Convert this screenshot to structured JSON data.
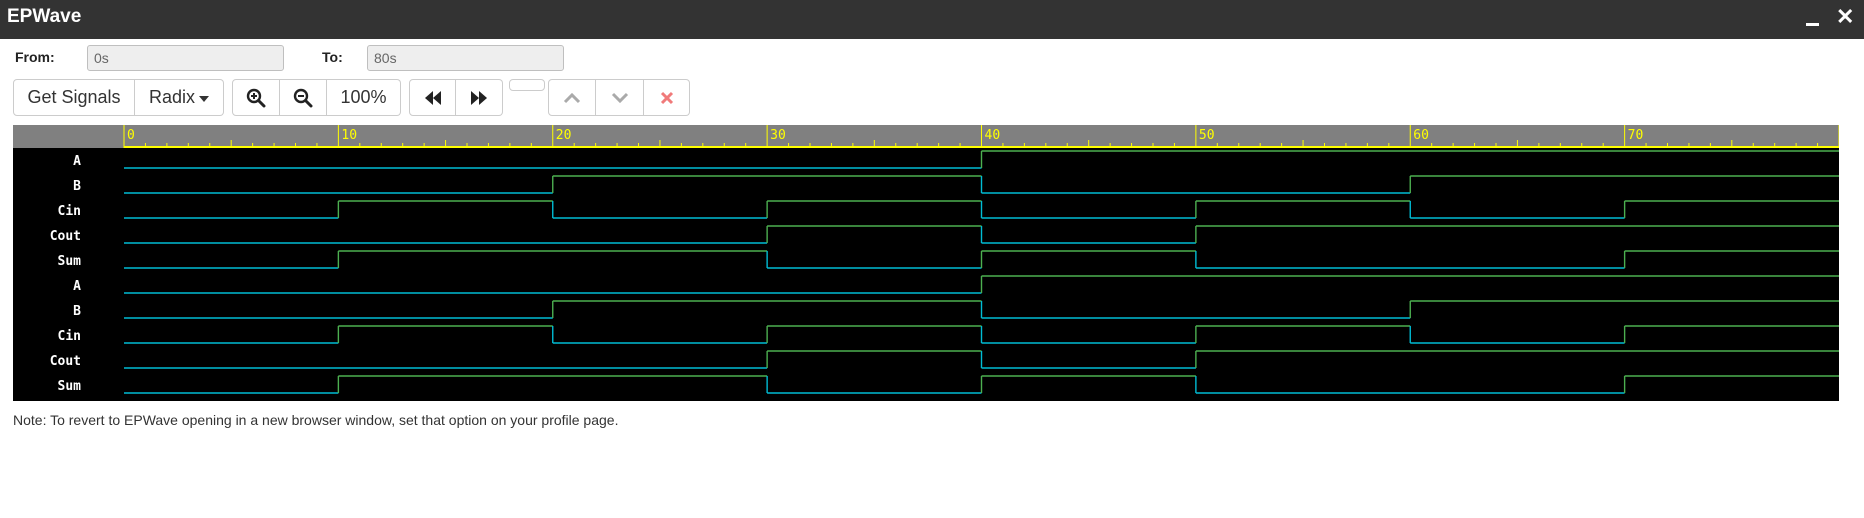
{
  "window": {
    "title": "EPWave",
    "minimize_label": "minimize",
    "close_label": "✕"
  },
  "range": {
    "from_label": "From:",
    "from_value": "0s",
    "to_label": "To:",
    "to_value": "80s"
  },
  "toolbar": {
    "get_signals": "Get Signals",
    "radix": "Radix",
    "zoom_in": "zoom-in",
    "zoom_out": "zoom-out",
    "zoom_level": "100%",
    "prev": "previous-transition",
    "next": "next-transition",
    "up": "move-up",
    "down": "move-down",
    "remove": "remove"
  },
  "colors": {
    "low": "#00bcd4",
    "high": "#4caf50",
    "ruler_bg": "#808080",
    "ruler_tick": "#ffff00",
    "bg": "#000000"
  },
  "timeline": {
    "start": 0,
    "end": 80,
    "major_step": 10,
    "minor_step": 1,
    "labels": [
      "0",
      "10",
      "20",
      "30",
      "40",
      "50",
      "60",
      "70"
    ]
  },
  "signals": [
    {
      "name": "A",
      "transitions": [
        [
          0,
          0
        ],
        [
          40,
          1
        ]
      ]
    },
    {
      "name": "B",
      "transitions": [
        [
          0,
          0
        ],
        [
          20,
          1
        ],
        [
          40,
          0
        ],
        [
          60,
          1
        ]
      ]
    },
    {
      "name": "Cin",
      "transitions": [
        [
          0,
          0
        ],
        [
          10,
          1
        ],
        [
          20,
          0
        ],
        [
          30,
          1
        ],
        [
          40,
          0
        ],
        [
          50,
          1
        ],
        [
          60,
          0
        ],
        [
          70,
          1
        ]
      ]
    },
    {
      "name": "Cout",
      "transitions": [
        [
          0,
          0
        ],
        [
          30,
          1
        ],
        [
          40,
          0
        ],
        [
          50,
          1
        ]
      ]
    },
    {
      "name": "Sum",
      "transitions": [
        [
          0,
          0
        ],
        [
          10,
          1
        ],
        [
          30,
          0
        ],
        [
          40,
          1
        ],
        [
          50,
          0
        ],
        [
          70,
          1
        ]
      ]
    },
    {
      "name": "A",
      "transitions": [
        [
          0,
          0
        ],
        [
          40,
          1
        ]
      ]
    },
    {
      "name": "B",
      "transitions": [
        [
          0,
          0
        ],
        [
          20,
          1
        ],
        [
          40,
          0
        ],
        [
          60,
          1
        ]
      ]
    },
    {
      "name": "Cin",
      "transitions": [
        [
          0,
          0
        ],
        [
          10,
          1
        ],
        [
          20,
          0
        ],
        [
          30,
          1
        ],
        [
          40,
          0
        ],
        [
          50,
          1
        ],
        [
          60,
          0
        ],
        [
          70,
          1
        ]
      ]
    },
    {
      "name": "Cout",
      "transitions": [
        [
          0,
          0
        ],
        [
          30,
          1
        ],
        [
          40,
          0
        ],
        [
          50,
          1
        ]
      ]
    },
    {
      "name": "Sum",
      "transitions": [
        [
          0,
          0
        ],
        [
          10,
          1
        ],
        [
          30,
          0
        ],
        [
          40,
          1
        ],
        [
          50,
          0
        ],
        [
          70,
          1
        ]
      ]
    }
  ],
  "note": "Note: To revert to EPWave opening in a new browser window, set that option on your profile page."
}
